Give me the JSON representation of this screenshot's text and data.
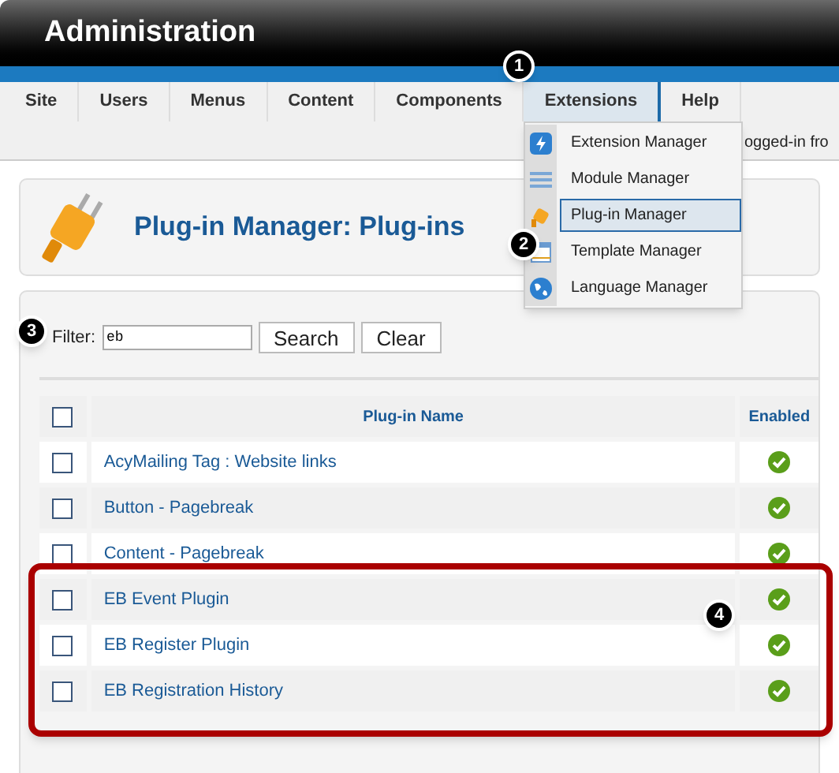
{
  "header": {
    "title": "Administration"
  },
  "menu": [
    {
      "label": "Site",
      "selected": false
    },
    {
      "label": "Users",
      "selected": false
    },
    {
      "label": "Menus",
      "selected": false
    },
    {
      "label": "Content",
      "selected": false
    },
    {
      "label": "Components",
      "selected": false
    },
    {
      "label": "Extensions",
      "selected": true
    },
    {
      "label": "Help",
      "selected": false
    }
  ],
  "status_text": "ogged-in fro",
  "dropdown": [
    {
      "label": "Extension Manager",
      "kind": "extension",
      "selected": false
    },
    {
      "label": "Module Manager",
      "kind": "module",
      "selected": false
    },
    {
      "label": "Plug-in Manager",
      "kind": "plugin",
      "selected": true
    },
    {
      "label": "Template Manager",
      "kind": "template",
      "selected": false
    },
    {
      "label": "Language Manager",
      "kind": "language",
      "selected": false
    }
  ],
  "page_title": "Plug-in Manager: Plug-ins",
  "filter": {
    "label": "Filter:",
    "value": "eb",
    "buttons": [
      "Search",
      "Clear"
    ]
  },
  "table": {
    "select_all_checked": false,
    "columns": [
      "Plug-in Name",
      "Enabled"
    ],
    "rows": [
      {
        "name": "AcyMailing Tag : Website links",
        "checked": false,
        "enabled": true
      },
      {
        "name": "Button - Pagebreak",
        "checked": false,
        "enabled": true
      },
      {
        "name": "Content - Pagebreak",
        "checked": false,
        "enabled": true
      },
      {
        "name": "EB Event Plugin",
        "checked": false,
        "enabled": true
      },
      {
        "name": "EB Register Plugin",
        "checked": false,
        "enabled": true
      },
      {
        "name": "EB Registration History",
        "checked": false,
        "enabled": true
      }
    ]
  },
  "callouts": [
    "1",
    "2",
    "3",
    "4"
  ]
}
